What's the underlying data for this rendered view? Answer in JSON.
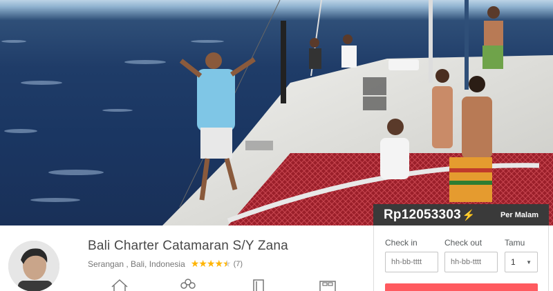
{
  "listing": {
    "title": "Bali Charter Catamaran S/Y Zana",
    "location": "Serangan , Bali, Indonesia",
    "rating": 4.5,
    "review_count": "(7)"
  },
  "price": {
    "amount": "Rp12053303",
    "period": "Per Malam"
  },
  "booking": {
    "checkin_label": "Check in",
    "checkout_label": "Check out",
    "guests_label": "Tamu",
    "checkin_placeholder": "hh-bb-tttt",
    "checkout_placeholder": "hh-bb-tttt",
    "guests_value": "1"
  },
  "amenity_icons": [
    "home-icon",
    "guests-icon",
    "door-icon",
    "bed-icon"
  ],
  "colors": {
    "accent": "#ff5a5f",
    "star": "#ffb400",
    "price_bar": "#3a3a3a"
  }
}
